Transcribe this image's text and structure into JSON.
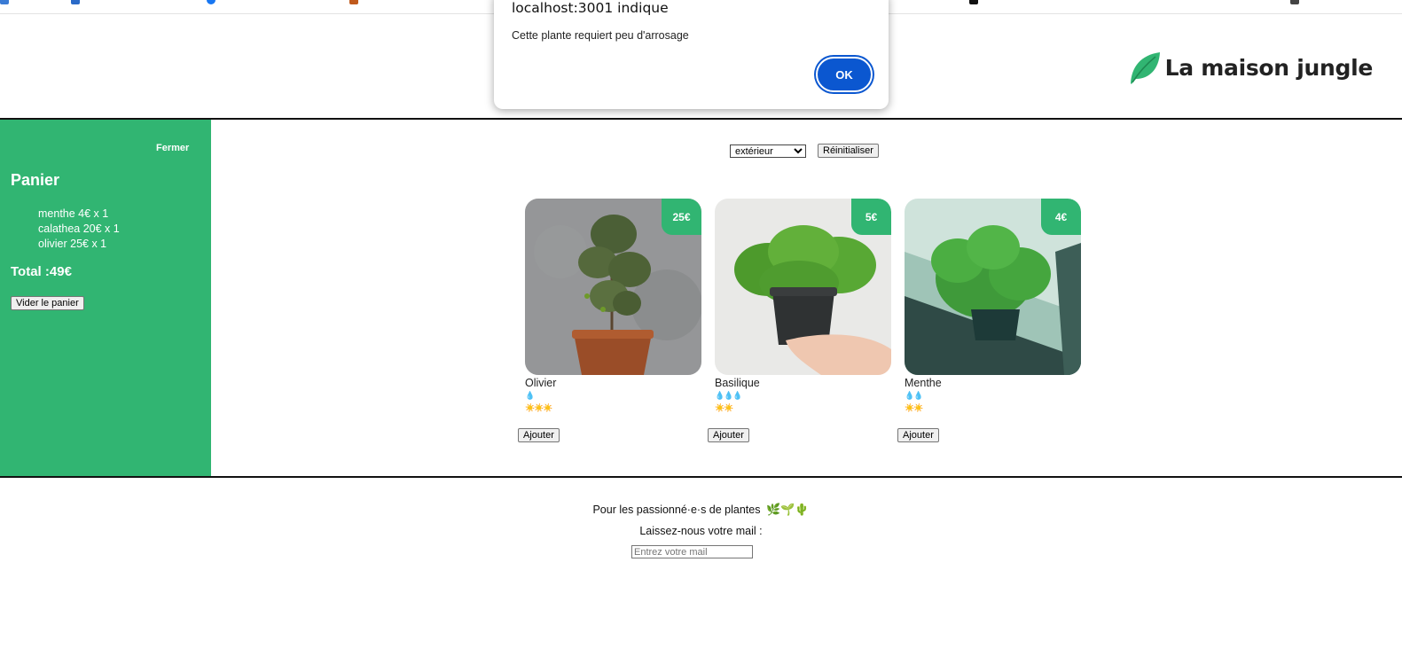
{
  "dialog": {
    "title": "localhost:3001 indique",
    "message": "Cette plante requiert peu d'arrosage",
    "ok_label": "OK"
  },
  "brand": {
    "title": "La maison jungle",
    "leaf_color": "#31b572"
  },
  "cart": {
    "close_label": "Fermer",
    "title": "Panier",
    "items": [
      {
        "text": "menthe 4€ x 1"
      },
      {
        "text": "calathea 20€ x 1"
      },
      {
        "text": "olivier 25€ x 1"
      }
    ],
    "total": "Total :49€",
    "empty_label": "Vider le panier",
    "bg_color": "#31b572"
  },
  "filters": {
    "category_selected": "extérieur",
    "reset_label": "Réinitialiser"
  },
  "plants": [
    {
      "name": "Olivier",
      "price": "25€",
      "water": "💧",
      "light": "☀️☀️☀️",
      "add_label": "Ajouter",
      "water_level": 1,
      "light_level": 3
    },
    {
      "name": "Basilique",
      "price": "5€",
      "water": "💧💧💧",
      "light": "☀️☀️",
      "add_label": "Ajouter",
      "water_level": 3,
      "light_level": 2
    },
    {
      "name": "Menthe",
      "price": "4€",
      "water": "💧💧",
      "light": "☀️☀️",
      "add_label": "Ajouter",
      "water_level": 2,
      "light_level": 2
    }
  ],
  "footer": {
    "tagline": "Pour les passionné·e·s de plantes",
    "emojis": "🌿🌱🌵",
    "mail_prompt": "Laissez-nous votre mail :",
    "mail_placeholder": "Entrez votre mail"
  }
}
